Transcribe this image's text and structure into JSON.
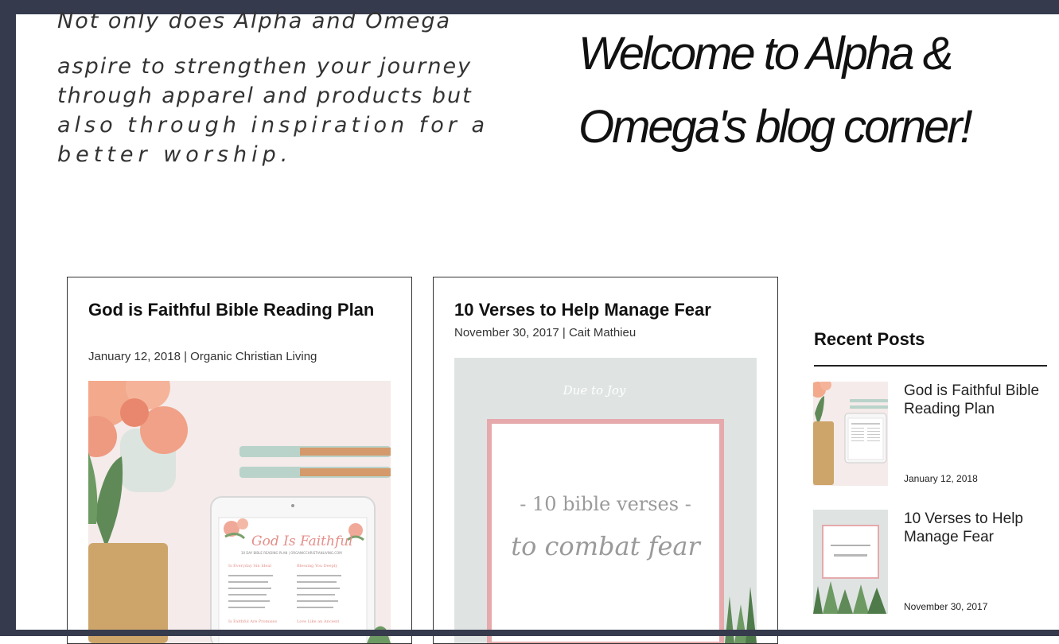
{
  "intro": {
    "line1": "Not only does Alpha and Omega",
    "line2": "aspire to strengthen your journey",
    "line3": "through apparel and products but",
    "line4": "also through inspiration for a",
    "line5": "better worship."
  },
  "welcome": {
    "line1": "Welcome to Alpha &",
    "line2": "Omega's blog  corner!"
  },
  "posts": [
    {
      "title": "God is Faithful Bible Reading Plan",
      "meta": "January 12, 2018   | Organic Christian Living",
      "image": {
        "tablet_title": "God Is Faithful",
        "tablet_subtitle": "30 DAY BIBLE READING PLAN | ORGANICCHRISTIANLIVING.COM",
        "col1_heading": "Is Everyday Sin Ideal",
        "col2_heading": "Blessing You Deeply",
        "col3_heading": "Is Faithful Are Promises",
        "col4_heading": "Love Like an Ancient"
      }
    },
    {
      "title": "10 Verses to Help Manage Fear",
      "meta": "November 30, 2017   | Cait Mathieu",
      "image": {
        "script_top": "Due to Joy",
        "headline": "- 10 bible verses -",
        "script_main": "to combat fear"
      }
    }
  ],
  "sidebar": {
    "title": "Recent Posts",
    "items": [
      {
        "title": "God is Faithful Bible Reading Plan",
        "date": "January 12, 2018"
      },
      {
        "title": "10 Verses to Help Manage Fear",
        "date": "November 30, 2017"
      }
    ]
  },
  "colors": {
    "frame": "#363a4d",
    "accent_pink": "#e6a9ac",
    "text": "#111111"
  }
}
